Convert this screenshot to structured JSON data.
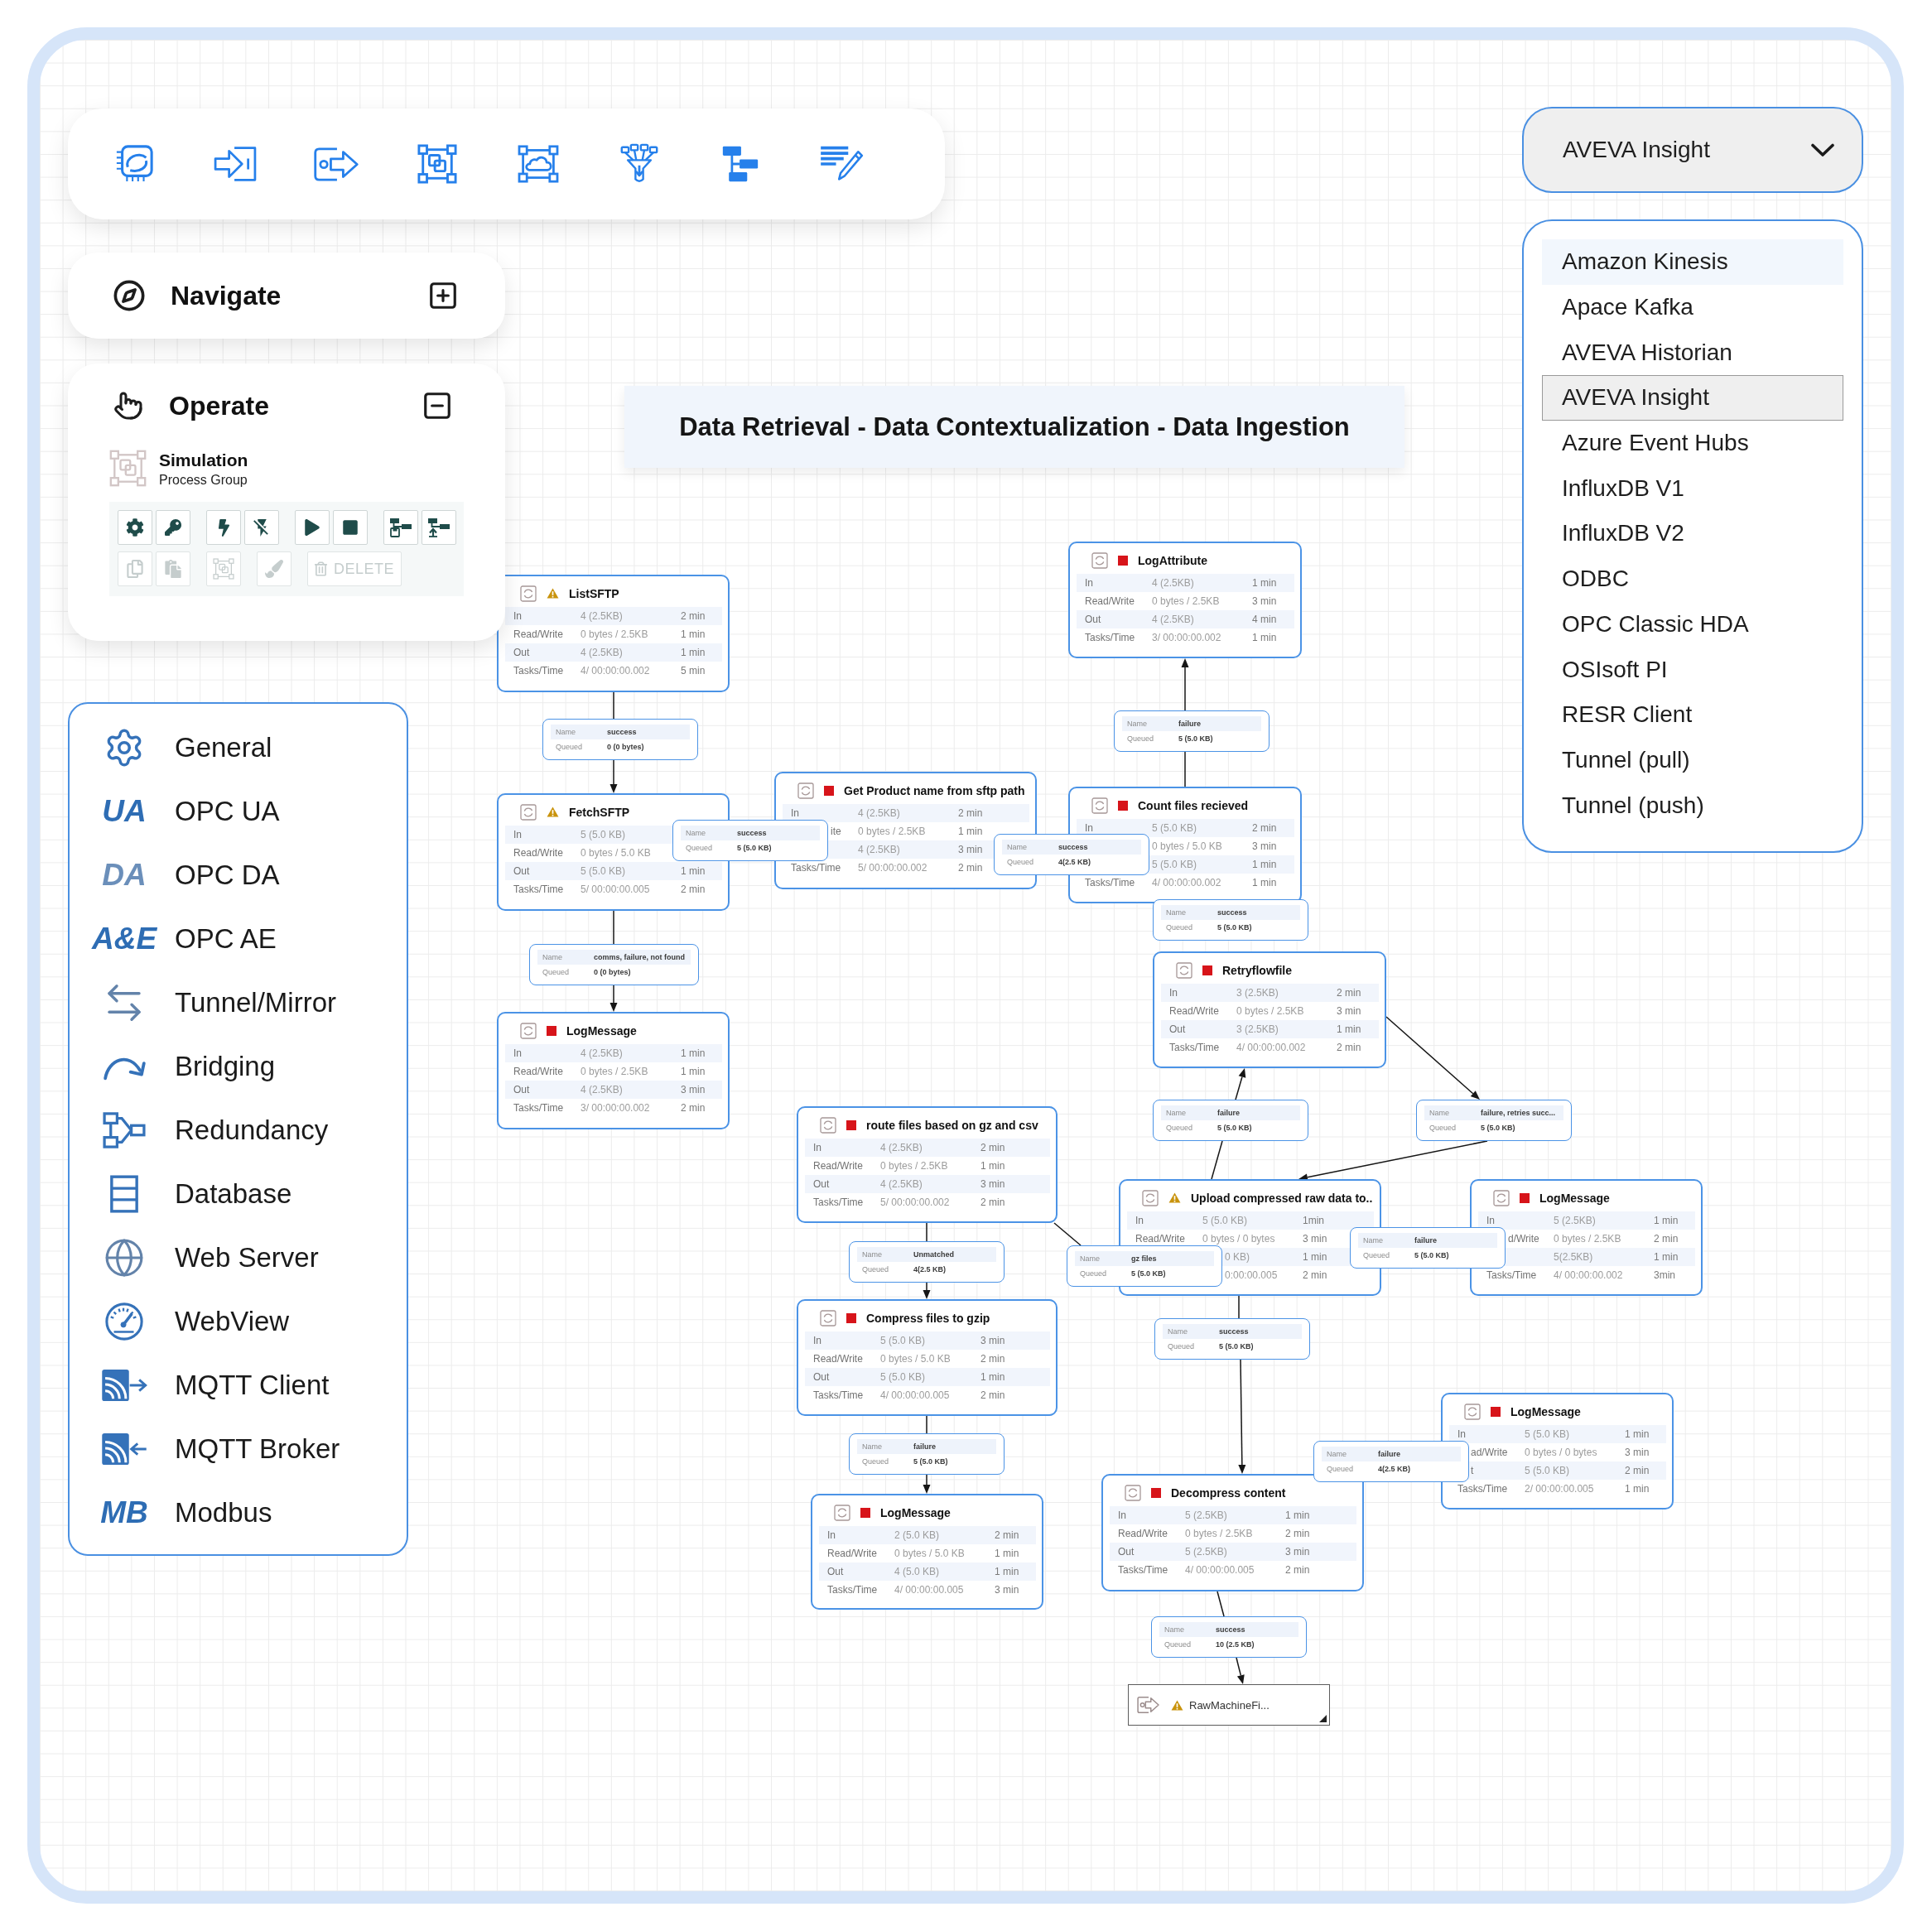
{
  "navigate": {
    "title": "Navigate",
    "expanded": false
  },
  "operate": {
    "title": "Operate",
    "expanded": true,
    "selection": {
      "name": "Simulation",
      "type": "Process Group"
    },
    "actions": [
      {
        "disabled": false
      },
      {
        "disabled": false
      },
      {
        "disabled": false
      },
      {
        "disabled": false
      },
      {
        "disabled": false
      },
      {
        "disabled": false
      },
      {
        "disabled": false
      },
      {
        "disabled": false
      },
      {
        "disabled": true
      },
      {
        "disabled": true
      },
      {
        "disabled": true
      },
      {
        "disabled": true
      },
      {
        "label": "DELETE",
        "disabled": true
      }
    ]
  },
  "canvas": {
    "banner": "Data Retrieval - Data Contextualization - Data Ingestion",
    "nodes": [
      {
        "kind": "processor",
        "name": "ListSFTP",
        "warning": true,
        "stopped": false,
        "rows": [
          {
            "label": "In",
            "value": "4 (2.5KB)",
            "time": "2 min"
          },
          {
            "label": "Read/Write",
            "value": "0 bytes / 2.5KB",
            "time": "1 min"
          },
          {
            "label": "Out",
            "value": "4 (2.5KB)",
            "time": "1 min"
          },
          {
            "label": "Tasks/Time",
            "value": "4/ 00:00:00.002",
            "time": "5 min"
          }
        ]
      },
      {
        "kind": "processor",
        "name": "LogAttribute",
        "warning": false,
        "stopped": true,
        "rows": [
          {
            "label": "In",
            "value": "4 (2.5KB)",
            "time": "1 min"
          },
          {
            "label": "Read/Write",
            "value": "0 bytes / 2.5KB",
            "time": "3 min"
          },
          {
            "label": "Out",
            "value": "4 (2.5KB)",
            "time": "4 min"
          },
          {
            "label": "Tasks/Time",
            "value": "3/ 00:00:00.002",
            "time": "1 min"
          }
        ]
      },
      {
        "kind": "processor",
        "name": "FetchSFTP",
        "warning": true,
        "stopped": false,
        "rows": [
          {
            "label": "In",
            "value": "5 (5.0 KB)"
          },
          {
            "label": "Read/Write",
            "value": "0 bytes / 5.0 KB"
          },
          {
            "label": "Out",
            "value": "5 (5.0 KB)",
            "time": "1 min"
          },
          {
            "label": "Tasks/Time",
            "value": "5/ 00:00:00.005",
            "time": "2 min"
          }
        ]
      },
      {
        "kind": "processor",
        "name": "Get Product name from sftp path",
        "warning": false,
        "stopped": true,
        "rows": [
          {
            "label": "In",
            "value": "4 (2.5KB)",
            "time": "2 min"
          },
          {
            "label": "ite",
            "value": "0 bytes / 2.5KB",
            "time": "1 min"
          },
          {
            "value": "4 (2.5KB)",
            "time": "3 min"
          },
          {
            "label": "Tasks/Time",
            "value": "5/ 00:00:00.002",
            "time": "2 min"
          }
        ]
      },
      {
        "kind": "processor",
        "name": "Count files recieved",
        "warning": false,
        "stopped": true,
        "rows": [
          {
            "label": "In",
            "value": "5 (5.0 KB)",
            "time": "2 min"
          },
          {
            "value": "0 bytes / 5.0 KB",
            "time": "3 min"
          },
          {
            "value": "5 (5.0 KB)",
            "time": "1 min"
          },
          {
            "label": "Tasks/Time",
            "value": "4/ 00:00:00.002",
            "time": "1 min"
          }
        ]
      },
      {
        "kind": "processor",
        "name": "Retryflowfile",
        "warning": false,
        "stopped": true,
        "rows": [
          {
            "label": "In",
            "value": "3 (2.5KB)",
            "time": "2 min"
          },
          {
            "label": "Read/Write",
            "value": "0 bytes / 2.5KB",
            "time": "3 min"
          },
          {
            "label": "Out",
            "value": "3 (2.5KB)",
            "time": "1 min"
          },
          {
            "label": "Tasks/Time",
            "value": "4/ 00:00:00.002",
            "time": "2 min"
          }
        ]
      },
      {
        "kind": "processor",
        "name": "LogMessage",
        "warning": false,
        "stopped": true,
        "rows": [
          {
            "label": "In",
            "value": "4 (2.5KB)",
            "time": "1 min"
          },
          {
            "label": "Read/Write",
            "value": "0 bytes / 2.5KB",
            "time": "1 min"
          },
          {
            "label": "Out",
            "value": "4 (2.5KB)",
            "time": "3 min"
          },
          {
            "label": "Tasks/Time",
            "value": "3/ 00:00:00.002",
            "time": "2 min"
          }
        ]
      },
      {
        "kind": "processor",
        "name": "route files based on gz and csv",
        "warning": false,
        "stopped": true,
        "rows": [
          {
            "label": "In",
            "value": "4 (2.5KB)",
            "time": "2 min"
          },
          {
            "label": "Read/Write",
            "value": "0 bytes / 2.5KB",
            "time": "1 min"
          },
          {
            "label": "Out",
            "value": "4 (2.5KB)",
            "time": "3 min"
          },
          {
            "label": "Tasks/Time",
            "value": "5/ 00:00:00.002",
            "time": "2 min"
          }
        ]
      },
      {
        "kind": "processor",
        "name": "Upload compressed raw data to..",
        "warning": true,
        "stopped": false,
        "rows": [
          {
            "label": "In",
            "value": "5 (5.0 KB)",
            "time": "1min"
          },
          {
            "label": "Read/Write",
            "value": "0 bytes / 0 bytes",
            "time": "3 min"
          },
          {
            "value": "0 KB)",
            "time": "1 min"
          },
          {
            "value": "0:00:00.005",
            "time": "2 min"
          }
        ]
      },
      {
        "kind": "processor",
        "name": "LogMessage",
        "warning": false,
        "stopped": true,
        "rows": [
          {
            "label": "In",
            "value": "5 (2.5KB)",
            "time": "1 min"
          },
          {
            "label": "d/Write",
            "value": "0 bytes / 2.5KB",
            "time": "2 min"
          },
          {
            "value": "5(2.5KB)",
            "time": "1 min"
          },
          {
            "label": "Tasks/Time",
            "value": "4/ 00:00:00.002",
            "time": "3min"
          }
        ]
      },
      {
        "kind": "processor",
        "name": "Compress files to gzip",
        "warning": false,
        "stopped": true,
        "rows": [
          {
            "label": "In",
            "value": "5 (5.0 KB)",
            "time": "3 min"
          },
          {
            "label": "Read/Write",
            "value": "0 bytes / 5.0 KB",
            "time": "2 min"
          },
          {
            "label": "Out",
            "value": "5 (5.0 KB)",
            "time": "1 min"
          },
          {
            "label": "Tasks/Time",
            "value": "4/ 00:00:00.005",
            "time": "2 min"
          }
        ]
      },
      {
        "kind": "processor",
        "name": "LogMessage",
        "warning": false,
        "stopped": true,
        "rows": [
          {
            "label": "In",
            "value": "5 (5.0 KB)",
            "time": "1 min"
          },
          {
            "label": "ad/Write",
            "value": "0 bytes / 0 bytes",
            "time": "3 min"
          },
          {
            "label": "t",
            "value": "5 (5.0 KB)",
            "time": "2 min"
          },
          {
            "label": "Tasks/Time",
            "value": "2/ 00:00:00.005",
            "time": "1 min"
          }
        ]
      },
      {
        "kind": "processor",
        "name": "Decompress content",
        "warning": false,
        "stopped": true,
        "rows": [
          {
            "label": "In",
            "value": "5 (2.5KB)",
            "time": "1 min"
          },
          {
            "label": "Read/Write",
            "value": "0 bytes / 2.5KB",
            "time": "2 min"
          },
          {
            "label": "Out",
            "value": "5 (2.5KB)",
            "time": "3 min"
          },
          {
            "label": "Tasks/Time",
            "value": "4/ 00:00:00.005",
            "time": "2 min"
          }
        ]
      },
      {
        "kind": "processor",
        "name": "LogMessage",
        "warning": false,
        "stopped": true,
        "rows": [
          {
            "label": "In",
            "value": "2 (5.0 KB)",
            "time": "2 min"
          },
          {
            "label": "Read/Write",
            "value": "0 bytes / 5.0 KB",
            "time": "1 min"
          },
          {
            "label": "Out",
            "value": "4 (5.0 KB)",
            "time": "1 min"
          },
          {
            "label": "Tasks/Time",
            "value": "4/ 00:00:00.005",
            "time": "3 min"
          }
        ]
      },
      {
        "kind": "port",
        "name": "RawMachineFi...",
        "warning": true,
        "stopped": false
      }
    ],
    "connections": [
      {
        "name_label": "Name",
        "name": "success",
        "queued_label": "Queued",
        "queued": "0 (0 bytes)"
      },
      {
        "name_label": "Name",
        "name": "failure",
        "queued_label": "Queued",
        "queued": "5 (5.0 KB)"
      },
      {
        "name_label": "Name",
        "name": "success",
        "queued_label": "Queued",
        "queued": "5 (5.0 KB)"
      },
      {
        "name_label": "Name",
        "name": "success",
        "queued_label": "Queued",
        "queued": "4(2.5 KB)"
      },
      {
        "name_label": "Name",
        "name": "success",
        "queued_label": "Queued",
        "queued": "5 (5.0 KB)"
      },
      {
        "name_label": "Name",
        "name": "comms, failure, not found",
        "queued_label": "Queued",
        "queued": "0 (0 bytes)"
      },
      {
        "name_label": "Name",
        "name": "failure",
        "queued_label": "Queued",
        "queued": "5 (5.0 KB)"
      },
      {
        "name_label": "Name",
        "name": "failure, retries succ...",
        "queued_label": "Queued",
        "queued": "5 (5.0 KB)"
      },
      {
        "name_label": "Name",
        "name": "Unmatched",
        "queued_label": "Queued",
        "queued": "4(2.5 KB)"
      },
      {
        "name_label": "Name",
        "name": "gz files",
        "queued_label": "Queued",
        "queued": "5 (5.0 KB)"
      },
      {
        "name_label": "Name",
        "name": "failure",
        "queued_label": "Queued",
        "queued": "5 (5.0 KB)"
      },
      {
        "name_label": "Name",
        "name": "success",
        "queued_label": "Queued",
        "queued": "5 (5.0 KB)"
      },
      {
        "name_label": "Name",
        "name": "failure",
        "queued_label": "Queued",
        "queued": "5 (5.0 KB)"
      },
      {
        "name_label": "Name",
        "name": "failure",
        "queued_label": "Queued",
        "queued": "4(2.5 KB)"
      },
      {
        "name_label": "Name",
        "name": "success",
        "queued_label": "Queued",
        "queued": "10 (2.5 KB)"
      }
    ]
  },
  "connectors": [
    {
      "kind": "icon",
      "label": "General"
    },
    {
      "kind": "letters",
      "letters": "UA",
      "label": "OPC UA"
    },
    {
      "kind": "letters",
      "letters": "DA",
      "label": "OPC DA"
    },
    {
      "kind": "letters",
      "letters": "A&E",
      "label": "OPC AE"
    },
    {
      "kind": "icon",
      "label": "Tunnel/Mirror"
    },
    {
      "kind": "icon",
      "label": "Bridging"
    },
    {
      "kind": "icon",
      "label": "Redundancy"
    },
    {
      "kind": "icon",
      "label": "Database"
    },
    {
      "kind": "icon",
      "label": "Web Server"
    },
    {
      "kind": "icon",
      "label": "WebView"
    },
    {
      "kind": "icon",
      "label": "MQTT Client"
    },
    {
      "kind": "icon",
      "label": "MQTT Broker"
    },
    {
      "kind": "letters",
      "letters": "MB",
      "label": "Modbus"
    }
  ],
  "data_source": {
    "value": "AVEVA Insight",
    "expanded": true,
    "options": [
      {
        "label": "Amazon Kinesis",
        "selected": false,
        "hovered": true
      },
      {
        "label": "Apace Kafka",
        "selected": false,
        "hovered": false
      },
      {
        "label": "AVEVA Historian",
        "selected": false,
        "hovered": false
      },
      {
        "label": "AVEVA Insight",
        "selected": true,
        "hovered": false
      },
      {
        "label": "Azure Event Hubs",
        "selected": false,
        "hovered": false
      },
      {
        "label": "InfluxDB V1",
        "selected": false,
        "hovered": false
      },
      {
        "label": "InfluxDB V2",
        "selected": false,
        "hovered": false
      },
      {
        "label": "ODBC",
        "selected": false,
        "hovered": false
      },
      {
        "label": "OPC Classic HDA",
        "selected": false,
        "hovered": false
      },
      {
        "label": "OSIsoft PI",
        "selected": false,
        "hovered": false
      },
      {
        "label": "RESR Client",
        "selected": false,
        "hovered": false
      },
      {
        "label": "Tunnel (pull)",
        "selected": false,
        "hovered": false
      },
      {
        "label": "Tunnel (push)",
        "selected": false,
        "hovered": false
      }
    ]
  }
}
